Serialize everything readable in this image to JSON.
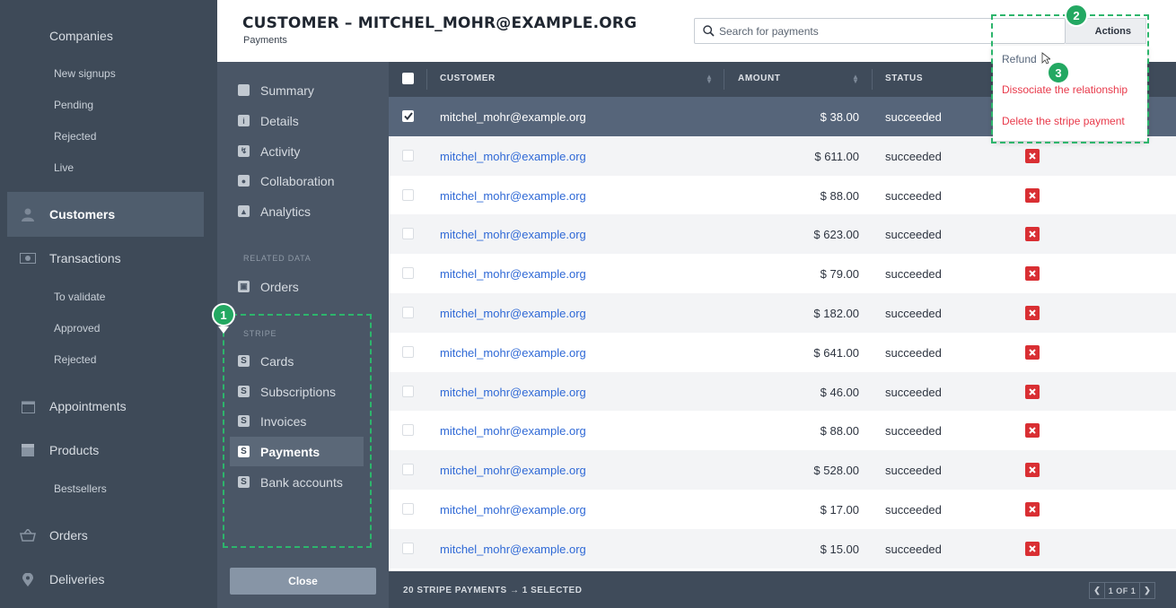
{
  "sidebar": {
    "companies": "Companies",
    "companies_sub": [
      "New signups",
      "Pending",
      "Rejected",
      "Live"
    ],
    "customers": "Customers",
    "transactions": "Transactions",
    "transactions_sub": [
      "To validate",
      "Approved",
      "Rejected"
    ],
    "appointments": "Appointments",
    "products": "Products",
    "products_sub": [
      "Bestsellers"
    ],
    "orders": "Orders",
    "deliveries": "Deliveries"
  },
  "header": {
    "title": "CUSTOMER – MITCHEL_MOHR@EXAMPLE.ORG",
    "subtitle": "Payments",
    "search_placeholder": "Search for payments",
    "actions_label": "Actions"
  },
  "subnav": {
    "items": [
      "Summary",
      "Details",
      "Activity",
      "Collaboration",
      "Analytics"
    ],
    "related_data_heading": "RELATED DATA",
    "orders": "Orders",
    "stripe_heading": "STRIPE",
    "stripe_items": [
      "Cards",
      "Subscriptions",
      "Invoices",
      "Payments",
      "Bank accounts"
    ],
    "stripe_icon_letter": "S",
    "close_label": "Close"
  },
  "table": {
    "headers": {
      "customer": "CUSTOMER",
      "amount": "AMOUNT",
      "status": "STATUS"
    },
    "rows": [
      {
        "customer": "mitchel_mohr@example.org",
        "amount": "$ 38.00",
        "status": "succeeded",
        "selected": true
      },
      {
        "customer": "mitchel_mohr@example.org",
        "amount": "$ 611.00",
        "status": "succeeded"
      },
      {
        "customer": "mitchel_mohr@example.org",
        "amount": "$ 88.00",
        "status": "succeeded"
      },
      {
        "customer": "mitchel_mohr@example.org",
        "amount": "$ 623.00",
        "status": "succeeded"
      },
      {
        "customer": "mitchel_mohr@example.org",
        "amount": "$ 79.00",
        "status": "succeeded"
      },
      {
        "customer": "mitchel_mohr@example.org",
        "amount": "$ 182.00",
        "status": "succeeded"
      },
      {
        "customer": "mitchel_mohr@example.org",
        "amount": "$ 641.00",
        "status": "succeeded"
      },
      {
        "customer": "mitchel_mohr@example.org",
        "amount": "$ 46.00",
        "status": "succeeded"
      },
      {
        "customer": "mitchel_mohr@example.org",
        "amount": "$ 88.00",
        "status": "succeeded"
      },
      {
        "customer": "mitchel_mohr@example.org",
        "amount": "$ 528.00",
        "status": "succeeded"
      },
      {
        "customer": "mitchel_mohr@example.org",
        "amount": "$ 17.00",
        "status": "succeeded"
      },
      {
        "customer": "mitchel_mohr@example.org",
        "amount": "$ 15.00",
        "status": "succeeded"
      }
    ],
    "footer_summary": "20 STRIPE PAYMENTS → 1 SELECTED",
    "pager_label": "1 OF 1"
  },
  "actions_menu": {
    "refund": "Refund",
    "dissociate": "Dissociate the relationship",
    "delete": "Delete the stripe payment"
  },
  "annotations": {
    "badge_1": "1",
    "badge_2": "2",
    "badge_3": "3"
  },
  "colors": {
    "sidebar_bg": "#3e4a58",
    "subnav_bg": "#4a5666",
    "link_blue": "#2f69d6",
    "danger_red": "#d92f33",
    "annotation_green": "#23a862"
  }
}
